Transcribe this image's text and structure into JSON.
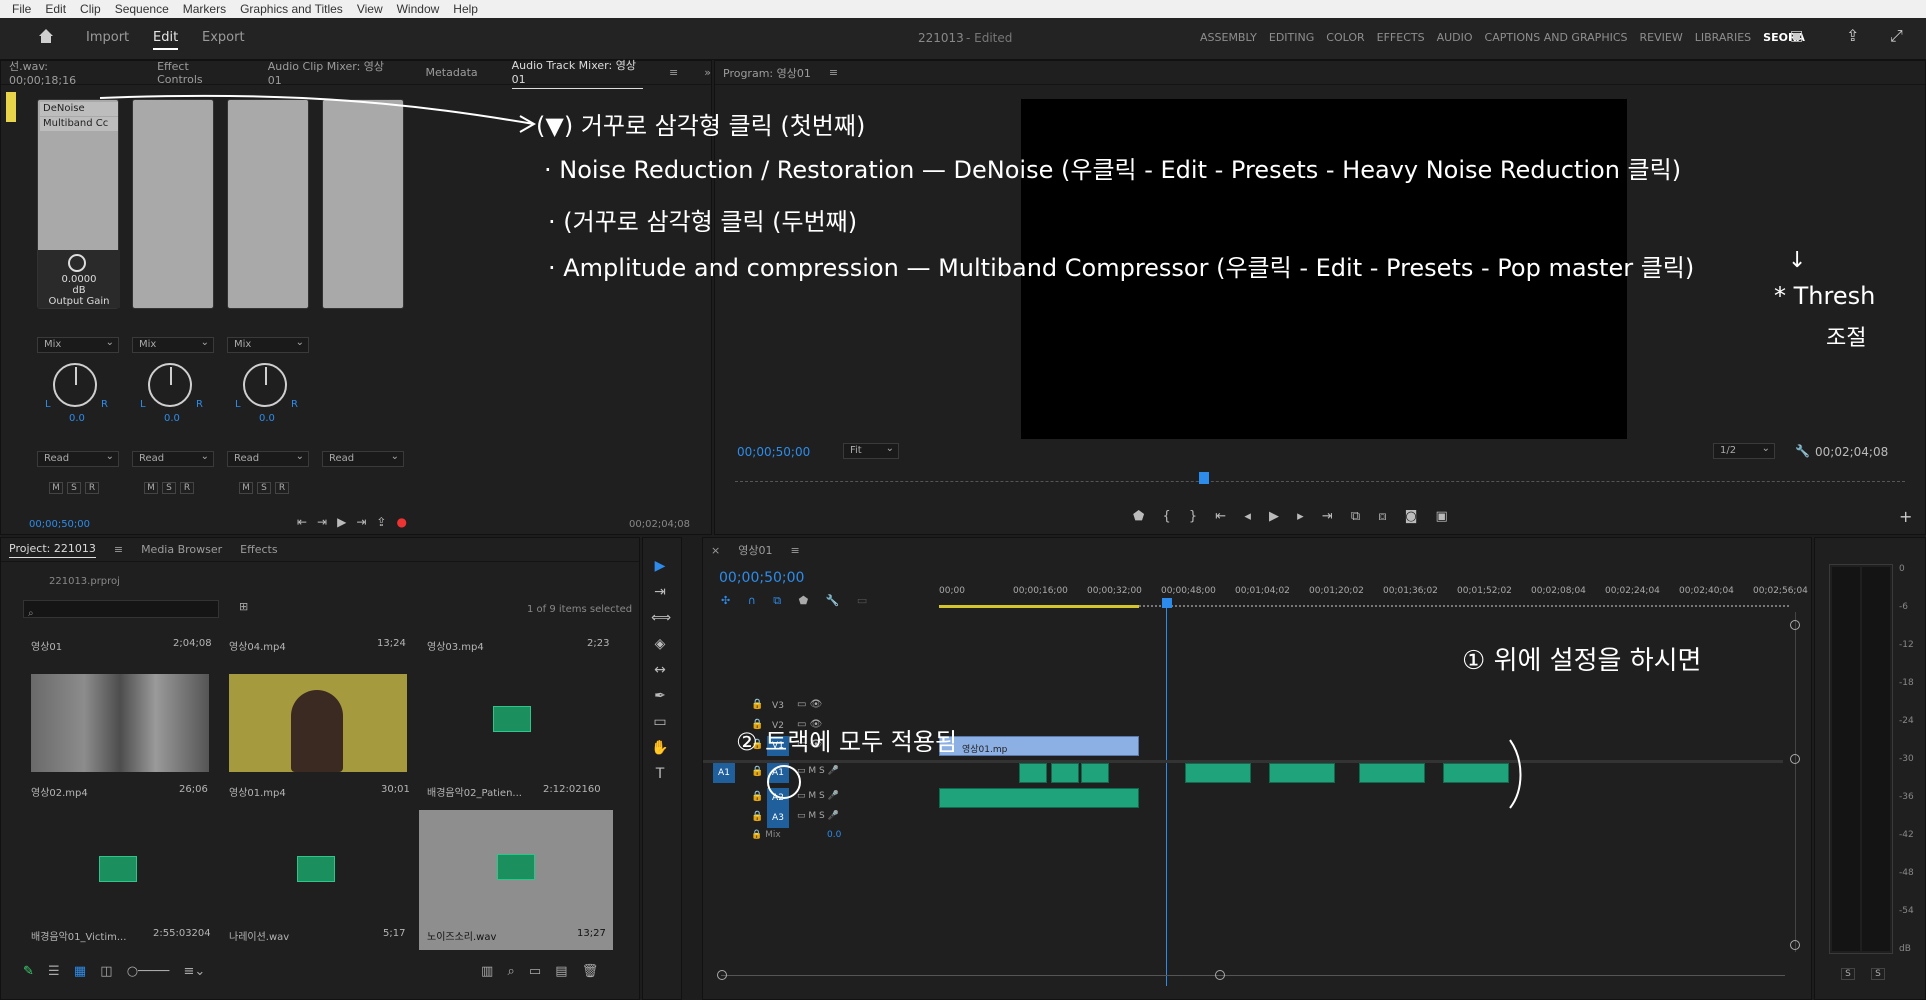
{
  "menubar": [
    "File",
    "Edit",
    "Clip",
    "Sequence",
    "Markers",
    "Graphics and Titles",
    "View",
    "Window",
    "Help"
  ],
  "workbar": {
    "tabs": [
      "Import",
      "Edit",
      "Export"
    ],
    "active_tab": "Edit",
    "doc_title": "221013",
    "doc_status": "- Edited",
    "workspaces": [
      "ASSEMBLY",
      "EDITING",
      "COLOR",
      "EFFECTS",
      "AUDIO",
      "CAPTIONS AND GRAPHICS",
      "REVIEW",
      "LIBRARIES",
      "SEORA"
    ],
    "active_workspace": "SEORA"
  },
  "source_panel": {
    "clip_label": "선.wav: 00;00;18;16",
    "tabs": [
      "Effect Controls",
      "Audio Clip Mixer: 영상01",
      "Metadata",
      "Audio Track Mixer: 영상01"
    ],
    "active_tab": "Audio Track Mixer: 영상01",
    "fx_slots": [
      "DeNoise",
      "Multiband Cc"
    ],
    "gain_value": "0.0000",
    "gain_unit": "dB",
    "gain_label": "Output Gain",
    "mix_label": "Mix",
    "read_label": "Read",
    "pan_value": "0.0",
    "pan_L": "L",
    "pan_R": "R",
    "msr": [
      "M",
      "S",
      "R"
    ],
    "timecode_left": "00;00;50;00",
    "timecode_right": "00;02;04;08"
  },
  "program": {
    "title": "Program: 영상01",
    "timecode": "00;00;50;00",
    "fit": "Fit",
    "resolution": "1/2",
    "duration": "00;02;04;08"
  },
  "project": {
    "tabs": [
      "Project: 221013",
      "Media Browser",
      "Effects"
    ],
    "file": "221013.prproj",
    "selected_info": "1 of 9 items selected",
    "items": [
      {
        "name": "영상01",
        "dur": "2;04;08",
        "label": "영상02.mp4",
        "label_dur": "26;06"
      },
      {
        "name": "영상04.mp4",
        "dur": "13;24",
        "label": "영상01.mp4",
        "label_dur": "30;01"
      },
      {
        "name": "영상03.mp4",
        "dur": "2;23",
        "label": "배경음악02_Patien...",
        "label_dur": "2:12:02160"
      },
      {
        "name": "",
        "dur": "",
        "label": "배경음악01_Victim...",
        "label_dur": "2:55:03204"
      },
      {
        "name": "",
        "dur": "",
        "label": "나레이션.wav",
        "label_dur": "5;17"
      },
      {
        "name": "",
        "dur": "",
        "label": "노이즈소리.wav",
        "label_dur": "13;27"
      }
    ]
  },
  "timeline": {
    "title": "영상01",
    "timecode": "00;00;50;00",
    "ruler": [
      "00;00",
      "00;00;16;00",
      "00;00;32;00",
      "00;00;48;00",
      "00;01;04;02",
      "00;01;20;02",
      "00;01;36;02",
      "00;01;52;02",
      "00;02;08;04",
      "00;02;24;04",
      "00;02;40;04",
      "00;02;56;04"
    ],
    "video_tracks": [
      "V3",
      "V2",
      "V1"
    ],
    "audio_tracks": [
      "A1",
      "A2",
      "A3"
    ],
    "source_patch": "A1",
    "mix_label": "Mix",
    "mix_value": "0.0",
    "v1_clip": "영상01.mp",
    "meter_scale": [
      "0",
      "-6",
      "-12",
      "-18",
      "-24",
      "-30",
      "-36",
      "-42",
      "-48",
      "-54",
      "dB"
    ],
    "meter_solo": [
      "S",
      "S"
    ]
  },
  "annotations": {
    "a1": "(▼) 거꾸로 삼각형 클릭 (첫번째)",
    "a2": "· Noise Reduction / Restoration  —  DeNoise (우클릭 - Edit - Presets - Heavy Noise Reduction 클릭)",
    "a3": "· (거꾸로 삼각형 클릭 (두번째)",
    "a4": "· Amplitude and compression  —  Multiband Compressor (우클릭 - Edit - Presets - Pop master 클릭)",
    "a5": "↓",
    "a6": "* Thresh",
    "a7": "조절",
    "a8": "① 위에 설정을 하시면",
    "a9": "② 트랙에 모두 적용됨"
  }
}
